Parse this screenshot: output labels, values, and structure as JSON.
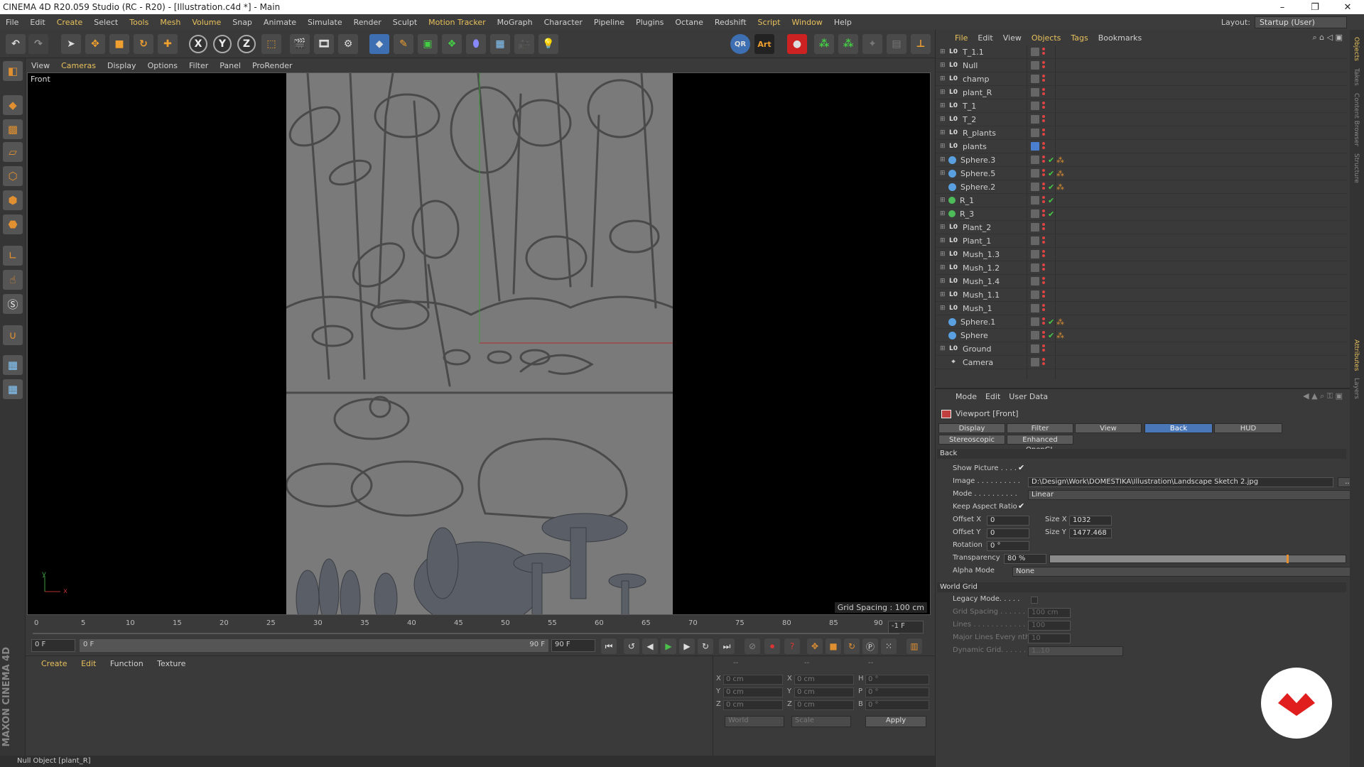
{
  "titlebar": {
    "title": "CINEMA 4D R20.059 Studio (RC - R20) - [Illustration.c4d *] - Main",
    "minimize": "–",
    "restore": "❐",
    "close": "✕"
  },
  "menubar": {
    "items": [
      "File",
      "Edit",
      "Create",
      "Select",
      "Tools",
      "Mesh",
      "Volume",
      "Snap",
      "Animate",
      "Simulate",
      "Render",
      "Sculpt",
      "Motion Tracker",
      "MoGraph",
      "Character",
      "Pipeline",
      "Plugins",
      "Octane",
      "Redshift",
      "Script",
      "Window",
      "Help"
    ],
    "layout_label": "Layout:",
    "layout_value": "Startup (User)"
  },
  "toolbar": {
    "x_label": "X",
    "y_label": "Y",
    "z_label": "Z",
    "qr_label": "QR",
    "art_label": "Art"
  },
  "viewport_menu": [
    "View",
    "Cameras",
    "Display",
    "Options",
    "Filter",
    "Panel",
    "ProRender"
  ],
  "viewport": {
    "label": "Front",
    "grid_spacing": "Grid Spacing : 100 cm",
    "axis_y": "y",
    "axis_x": "x"
  },
  "timeline": {
    "ticks": [
      "0",
      "5",
      "10",
      "15",
      "20",
      "25",
      "30",
      "35",
      "40",
      "45",
      "50",
      "55",
      "60",
      "65",
      "70",
      "75",
      "80",
      "85",
      "90"
    ],
    "current_frame": "-1 F",
    "start_frame": "0 F",
    "range_start": "0 F",
    "range_end": "90 F",
    "end_frame": "90 F"
  },
  "material_manager": {
    "menu": [
      "Create",
      "Edit",
      "Function",
      "Texture"
    ]
  },
  "coordinates": {
    "header_a": "--",
    "header_b": "--",
    "header_c": "--",
    "rows": [
      {
        "a_label": "X",
        "a_value": "0 cm",
        "b_label": "X",
        "b_value": "0 cm",
        "c_label": "H",
        "c_value": "0 °"
      },
      {
        "a_label": "Y",
        "a_value": "0 cm",
        "b_label": "Y",
        "b_value": "0 cm",
        "c_label": "P",
        "c_value": "0 °"
      },
      {
        "a_label": "Z",
        "a_value": "0 cm",
        "b_label": "Z",
        "b_value": "0 cm",
        "c_label": "B",
        "c_value": "0 °"
      }
    ],
    "space": "World",
    "mode": "Scale",
    "apply": "Apply"
  },
  "statusbar": {
    "text": "Null Object [plant_R]"
  },
  "object_manager": {
    "menu": [
      "File",
      "Edit",
      "View",
      "Objects",
      "Tags",
      "Bookmarks"
    ],
    "objects": [
      {
        "name": "T_1.1",
        "icon": "null"
      },
      {
        "name": "Null",
        "icon": "null"
      },
      {
        "name": "champ",
        "icon": "null"
      },
      {
        "name": "plant_R",
        "icon": "null"
      },
      {
        "name": "T_1",
        "icon": "null"
      },
      {
        "name": "T_2",
        "icon": "null"
      },
      {
        "name": "R_plants",
        "icon": "null"
      },
      {
        "name": "plants",
        "icon": "null"
      },
      {
        "name": "Sphere.3",
        "icon": "sphere"
      },
      {
        "name": "Sphere.5",
        "icon": "sphere"
      },
      {
        "name": "Sphere.2",
        "icon": "sphere"
      },
      {
        "name": "R_1",
        "icon": "green"
      },
      {
        "name": "R_3",
        "icon": "green"
      },
      {
        "name": "Plant_2",
        "icon": "null"
      },
      {
        "name": "Plant_1",
        "icon": "null"
      },
      {
        "name": "Mush_1.3",
        "icon": "null"
      },
      {
        "name": "Mush_1.2",
        "icon": "null"
      },
      {
        "name": "Mush_1.4",
        "icon": "null"
      },
      {
        "name": "Mush_1.1",
        "icon": "null"
      },
      {
        "name": "Mush_1",
        "icon": "null"
      },
      {
        "name": "Sphere.1",
        "icon": "sphere"
      },
      {
        "name": "Sphere",
        "icon": "sphere"
      },
      {
        "name": "Ground",
        "icon": "null"
      },
      {
        "name": "Camera",
        "icon": "cam"
      }
    ]
  },
  "attribute_manager": {
    "menu": [
      "Mode",
      "Edit",
      "User Data"
    ],
    "title": "Viewport [Front]",
    "tabs_row1": [
      "Display",
      "Filter",
      "View",
      "Back",
      "HUD"
    ],
    "tabs_row2": [
      "Stereoscopic",
      "Enhanced OpenGL"
    ],
    "section_back": "Back",
    "show_picture_label": "Show Picture . . . .",
    "image_label": "Image . . . . . . . . . .",
    "image_value": "D:\\Design\\Work\\DOMESTIKA\\Illustration\\Landscape Sketch 2.jpg",
    "image_btn": "...",
    "mode_label": "Mode . . . . . . . . . .",
    "mode_value": "Linear",
    "keep_aspect_label": "Keep Aspect Ratio",
    "offset_x_label": "Offset X",
    "offset_x_value": "0",
    "size_x_label": "Size X",
    "size_x_value": "1032",
    "offset_y_label": "Offset Y",
    "offset_y_value": "0",
    "size_y_label": "Size Y",
    "size_y_value": "1477.468",
    "rotation_label": "Rotation",
    "rotation_value": "0 °",
    "transparency_label": "Transparency",
    "transparency_value": "80 %",
    "transparency_fraction": 0.8,
    "alpha_mode_label": "Alpha Mode",
    "alpha_mode_value": "None",
    "section_world_grid": "World Grid",
    "legacy_mode_label": "Legacy Mode. . . . .",
    "grid_spacing_label": "Grid Spacing . . . . . . .",
    "grid_spacing_value": "100 cm",
    "lines_label": "Lines . . . . . . . . . . . .",
    "lines_value": "100",
    "major_lines_label": "Major Lines Every nth",
    "major_lines_value": "10",
    "dynamic_grid_label": "Dynamic Grid. . . . . .",
    "dynamic_grid_value": "1..10"
  },
  "side_tabs": [
    "Objects",
    "Takes",
    "Content Browser",
    "Structure"
  ],
  "side_tabs_lower": [
    "Attributes",
    "Layers"
  ],
  "colors": {
    "accent": "#e8c15c",
    "active_tab": "#4a77b8",
    "background": "#3a3a3a",
    "viewport_bg": "#000000",
    "brand_red": "#e01e1e"
  }
}
